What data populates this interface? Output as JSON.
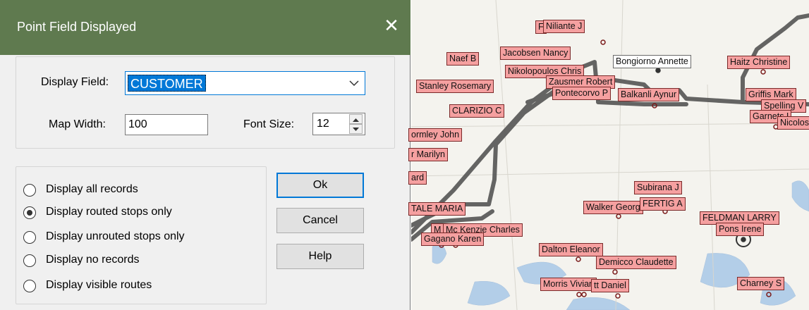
{
  "dialog": {
    "title": "Point Field Displayed",
    "close_glyph": "✕",
    "display_field_label": "Display Field:",
    "display_field_value": "CUSTOMER",
    "map_width_label": "Map Width:",
    "map_width_value": "100",
    "font_size_label": "Font Size:",
    "font_size_value": "12",
    "options": [
      {
        "label": "Display all records",
        "selected": false
      },
      {
        "label": "Display routed stops only",
        "selected": true
      },
      {
        "label": "Display unrouted stops only",
        "selected": false
      },
      {
        "label": "Display no records",
        "selected": false
      },
      {
        "label": "Display visible routes",
        "selected": false
      }
    ],
    "buttons": {
      "ok": "Ok",
      "cancel": "Cancel",
      "help": "Help"
    }
  },
  "map": {
    "colors": {
      "label_fill": "#f5a0a0",
      "label_border": "#7a2a2a",
      "route": "#555555",
      "water": "#a8c8e8",
      "titlebar": "#5f7a4f"
    },
    "labels": {
      "l1": "Niliante J",
      "l2": "F",
      "l3": "Naef B",
      "l4": "Jacobsen Nancy",
      "l5": "Bongiorno Annette",
      "l6": "Haitz Christine",
      "l7": "Nikolopoulos Chris",
      "l8": "Stanley Rosemary",
      "l9": "Zausmer Robert",
      "l10": "Pontecorvo P",
      "l11": "Balkanli Aynur",
      "l12": "Griffis Mark",
      "l13": "Spelling V",
      "l14": "CLARIZIO C",
      "l15": "Garnets I",
      "l16": "Nicolos",
      "l17": "ormley John",
      "l18": "r Marilyn",
      "l19": "ard",
      "l20": "Subirana J",
      "l21": "Walker Georg",
      "l22": "FERTIG A",
      "l23": "FELDMAN LARRY",
      "l24": "Pons Irene",
      "l25": "TALE MARIA",
      "l26": "Mc Kenzie Charles",
      "l27": "M",
      "l28": "Gagano Karen",
      "l29": "Dalton Eleanor",
      "l30": "Demicco Claudette",
      "l31": "Morris Vivian",
      "l32": "tt Daniel",
      "l33": "Charney S"
    }
  }
}
